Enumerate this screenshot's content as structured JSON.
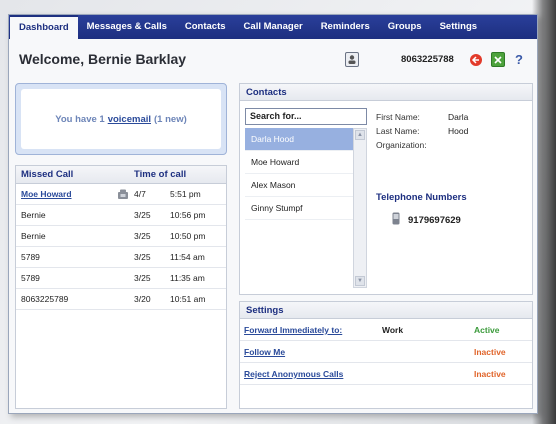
{
  "nav": {
    "items": [
      {
        "label": "Dashboard",
        "active": true
      },
      {
        "label": "Messages & Calls",
        "active": false
      },
      {
        "label": "Contacts",
        "active": false
      },
      {
        "label": "Call Manager",
        "active": false
      },
      {
        "label": "Reminders",
        "active": false
      },
      {
        "label": "Groups",
        "active": false
      },
      {
        "label": "Settings",
        "active": false
      }
    ]
  },
  "header": {
    "welcome": "Welcome, Bernie Barklay",
    "phone_number": "8063225788",
    "icons": [
      "contact-card-icon",
      "logout-icon",
      "export-icon",
      "help-icon"
    ]
  },
  "voicemail": {
    "prefix": "You have 1",
    "link": "voicemail",
    "suffix": "(1 new)"
  },
  "missed_calls": {
    "col_name": "Missed Call",
    "col_time": "Time of call",
    "rows": [
      {
        "name": "Moe Howard",
        "date": "4/7",
        "time": "5:51 pm",
        "linked": true
      },
      {
        "name": "Bernie",
        "date": "3/25",
        "time": "10:56 pm",
        "linked": false
      },
      {
        "name": "Bernie",
        "date": "3/25",
        "time": "10:50 pm",
        "linked": false
      },
      {
        "name": "5789",
        "date": "3/25",
        "time": "11:54 am",
        "linked": false
      },
      {
        "name": "5789",
        "date": "3/25",
        "time": "11:35 am",
        "linked": false
      },
      {
        "name": "8063225789",
        "date": "3/20",
        "time": "10:51 am",
        "linked": false
      }
    ]
  },
  "contacts": {
    "title": "Contacts",
    "search_value": "Search for...",
    "list": [
      "Darla Hood",
      "Moe Howard",
      "Alex Mason",
      "Ginny Stumpf"
    ],
    "selected_index": 0,
    "detail": {
      "first_name_label": "First Name:",
      "first_name": "Darla",
      "last_name_label": "Last Name:",
      "last_name": "Hood",
      "org_label": "Organization:",
      "org": ""
    },
    "tel_title": "Telephone Numbers",
    "tel_number": "9179697629"
  },
  "settings": {
    "title": "Settings",
    "rows": [
      {
        "label": "Forward Immediately to:",
        "value": "Work",
        "status": "Active",
        "status_color": "#3a9a3a"
      },
      {
        "label": "Follow Me",
        "value": "",
        "status": "Inactive",
        "status_color": "#e0642a"
      },
      {
        "label": "Reject Anonymous Calls",
        "value": "",
        "status": "Inactive",
        "status_color": "#e0642a"
      }
    ]
  },
  "colors": {
    "nav_bg": "#1d2f80",
    "accent": "#2a4a9a",
    "selected_row": "#97b0e0",
    "active": "#3a9a3a",
    "inactive": "#e0642a"
  }
}
